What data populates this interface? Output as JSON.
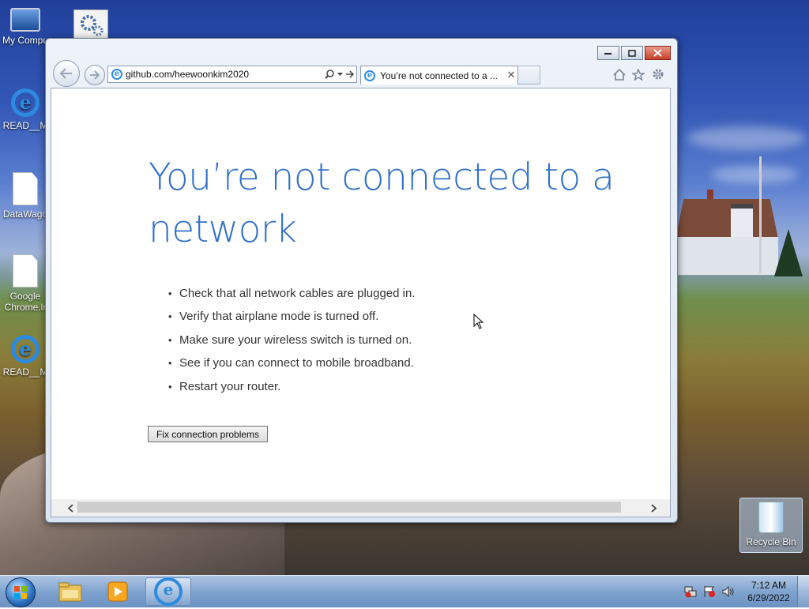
{
  "desktop": {
    "icons": [
      {
        "label": "My Compu"
      },
      {
        "label": "READ__M"
      },
      {
        "label": "DataWago"
      },
      {
        "label": "Google Chrome.lr"
      },
      {
        "label": "READ__M"
      },
      {
        "label": "Recycle Bin"
      }
    ]
  },
  "browser": {
    "address": "github.com/heewoonkim2020",
    "tab_title": "You’re not connected to a ...",
    "tab_close_glyph": "✕"
  },
  "page": {
    "title": "You’re not connected to a network",
    "tips": [
      "Check that all network cables are plugged in.",
      "Verify that airplane mode is turned off.",
      "Make sure your wireless switch is turned on.",
      "See if you can connect to mobile broadband.",
      "Restart your router."
    ],
    "fix_button": "Fix connection problems"
  },
  "taskbar": {
    "time": "7:12 AM",
    "date": "6/29/2022"
  },
  "colors": {
    "title_blue": "#3271c6",
    "ie_blue": "#2c8be0"
  }
}
